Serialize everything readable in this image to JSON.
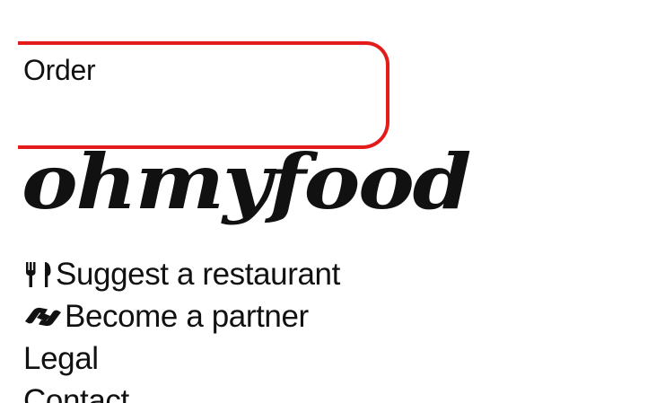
{
  "order": {
    "label": "Order",
    "border_color": "#e31b1b"
  },
  "logo": {
    "text": "ohmyfood"
  },
  "footer": {
    "items": [
      {
        "label": "Suggest a restaurant",
        "icon": "utensils-icon"
      },
      {
        "label": "Become a partner",
        "icon": "handshake-icon"
      },
      {
        "label": "Legal",
        "icon": ""
      },
      {
        "label": "Contact",
        "icon": ""
      }
    ]
  }
}
